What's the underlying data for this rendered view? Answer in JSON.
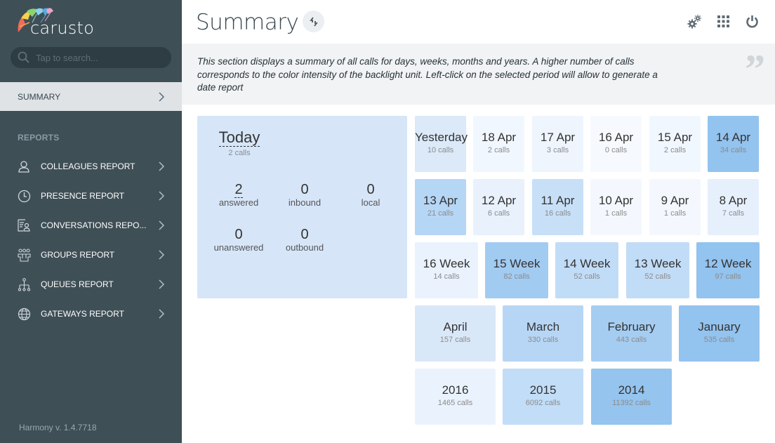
{
  "sidebar": {
    "logo_text": "carusto",
    "search_placeholder": "Tap to search...",
    "summary_label": "SUMMARY",
    "reports_heading": "REPORTS",
    "items": [
      {
        "label": "COLLEAGUES REPORT",
        "icon": "user-icon"
      },
      {
        "label": "PRESENCE REPORT",
        "icon": "clock-icon"
      },
      {
        "label": "CONVERSATIONS REPO...",
        "icon": "conversation-report-icon"
      },
      {
        "label": "GROUPS REPORT",
        "icon": "group-icon"
      },
      {
        "label": "QUEUES REPORT",
        "icon": "queue-icon"
      },
      {
        "label": "GATEWAYS REPORT",
        "icon": "globe-icon"
      }
    ],
    "version": "Harmony v. 1.4.7718"
  },
  "header": {
    "title": "Summary",
    "icons": [
      "refresh-icon",
      "settings-icon",
      "apps-grid-icon",
      "power-icon"
    ]
  },
  "info": {
    "text": "This section displays a summary of all calls for days, weeks, months and years. A higher number of calls corresponds to the color intensity of the backlight unit. Left-click on the selected period will allow to generate a date report",
    "quote_glyph": "”"
  },
  "today": {
    "title": "Today",
    "calls": "2 calls",
    "stats": [
      {
        "value": "2",
        "label": "answered"
      },
      {
        "value": "0",
        "label": "inbound"
      },
      {
        "value": "0",
        "label": "local"
      },
      {
        "value": "0",
        "label": "unanswered"
      },
      {
        "value": "0",
        "label": "outbound"
      }
    ]
  },
  "days_row1": [
    {
      "label": "Yesterday",
      "calls": "10 calls",
      "color": "#dbe9f9"
    },
    {
      "label": "18 Apr",
      "calls": "2 calls",
      "color": "#f1f7fe"
    },
    {
      "label": "17 Apr",
      "calls": "3 calls",
      "color": "#eef5fd"
    },
    {
      "label": "16 Apr",
      "calls": "0 calls",
      "color": "#f6f9fe"
    },
    {
      "label": "15 Apr",
      "calls": "2 calls",
      "color": "#f1f7fe"
    },
    {
      "label": "14 Apr",
      "calls": "34 calls",
      "color": "#93c3ef"
    }
  ],
  "days_row2": [
    {
      "label": "13 Apr",
      "calls": "21 calls",
      "color": "#b6d6f6"
    },
    {
      "label": "12 Apr",
      "calls": "6 calls",
      "color": "#e8f1fc"
    },
    {
      "label": "11 Apr",
      "calls": "16 calls",
      "color": "#c7e0f8"
    },
    {
      "label": "10 Apr",
      "calls": "1 calls",
      "color": "#f4f8fe"
    },
    {
      "label": "9 Apr",
      "calls": "1 calls",
      "color": "#f4f8fe"
    },
    {
      "label": "8 Apr",
      "calls": "7 calls",
      "color": "#e6f0fc"
    }
  ],
  "weeks": [
    {
      "label": "16 Week",
      "calls": "14 calls",
      "color": "#e9f2fd"
    },
    {
      "label": "15 Week",
      "calls": "82 calls",
      "color": "#a2cbf2"
    },
    {
      "label": "14 Week",
      "calls": "52 calls",
      "color": "#c1dcf7"
    },
    {
      "label": "13 Week",
      "calls": "52 calls",
      "color": "#c1dcf7"
    },
    {
      "label": "12 Week",
      "calls": "97 calls",
      "color": "#93c3ef"
    }
  ],
  "months": [
    {
      "label": "April",
      "calls": "157 calls",
      "color": "#d9e8f9"
    },
    {
      "label": "March",
      "calls": "330 calls",
      "color": "#b7d6f5"
    },
    {
      "label": "February",
      "calls": "443 calls",
      "color": "#a5cdf2"
    },
    {
      "label": "January",
      "calls": "535 calls",
      "color": "#93c3ef"
    }
  ],
  "years": [
    {
      "label": "2016",
      "calls": "1465 calls",
      "color": "#eaf3fd"
    },
    {
      "label": "2015",
      "calls": "6092 calls",
      "color": "#c2ddf7"
    },
    {
      "label": "2014",
      "calls": "11392 calls",
      "color": "#95c4ef"
    }
  ]
}
